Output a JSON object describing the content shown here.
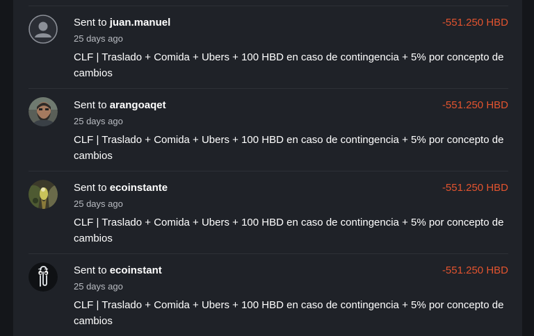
{
  "transfers": [
    {
      "prefix": "Sent to",
      "recipient": "juan.manuel",
      "time": "25 days ago",
      "amount": "-551.250 HBD",
      "memo": "CLF | Traslado + Comida + Ubers + 100 HBD en caso de contingencia + 5% por concepto de cambios",
      "avatar_icon": "default-user-icon"
    },
    {
      "prefix": "Sent to",
      "recipient": "arangoaqet",
      "time": "25 days ago",
      "amount": "-551.250 HBD",
      "memo": "CLF | Traslado + Comida + Ubers + 100 HBD en caso de contingencia + 5% por concepto de cambios",
      "avatar_icon": "bearded-man-photo"
    },
    {
      "prefix": "Sent to",
      "recipient": "ecoinstante",
      "time": "25 days ago",
      "amount": "-551.250 HBD",
      "memo": "CLF | Traslado + Comida + Ubers + 100 HBD en caso de contingencia + 5% por concepto de cambios",
      "avatar_icon": "nature-photo"
    },
    {
      "prefix": "Sent to",
      "recipient": "ecoinstant",
      "time": "25 days ago",
      "amount": "-551.250 HBD",
      "memo": "CLF | Traslado + Comida + Ubers + 100 HBD en caso de contingencia + 5% por concepto de cambios",
      "avatar_icon": "paperclip-mascot-icon"
    }
  ],
  "colors": {
    "background": "#14161a",
    "panel": "#1f2228",
    "divider": "#2d3037",
    "amount_negative": "#e3542f",
    "muted_text": "#b9bcc2"
  }
}
